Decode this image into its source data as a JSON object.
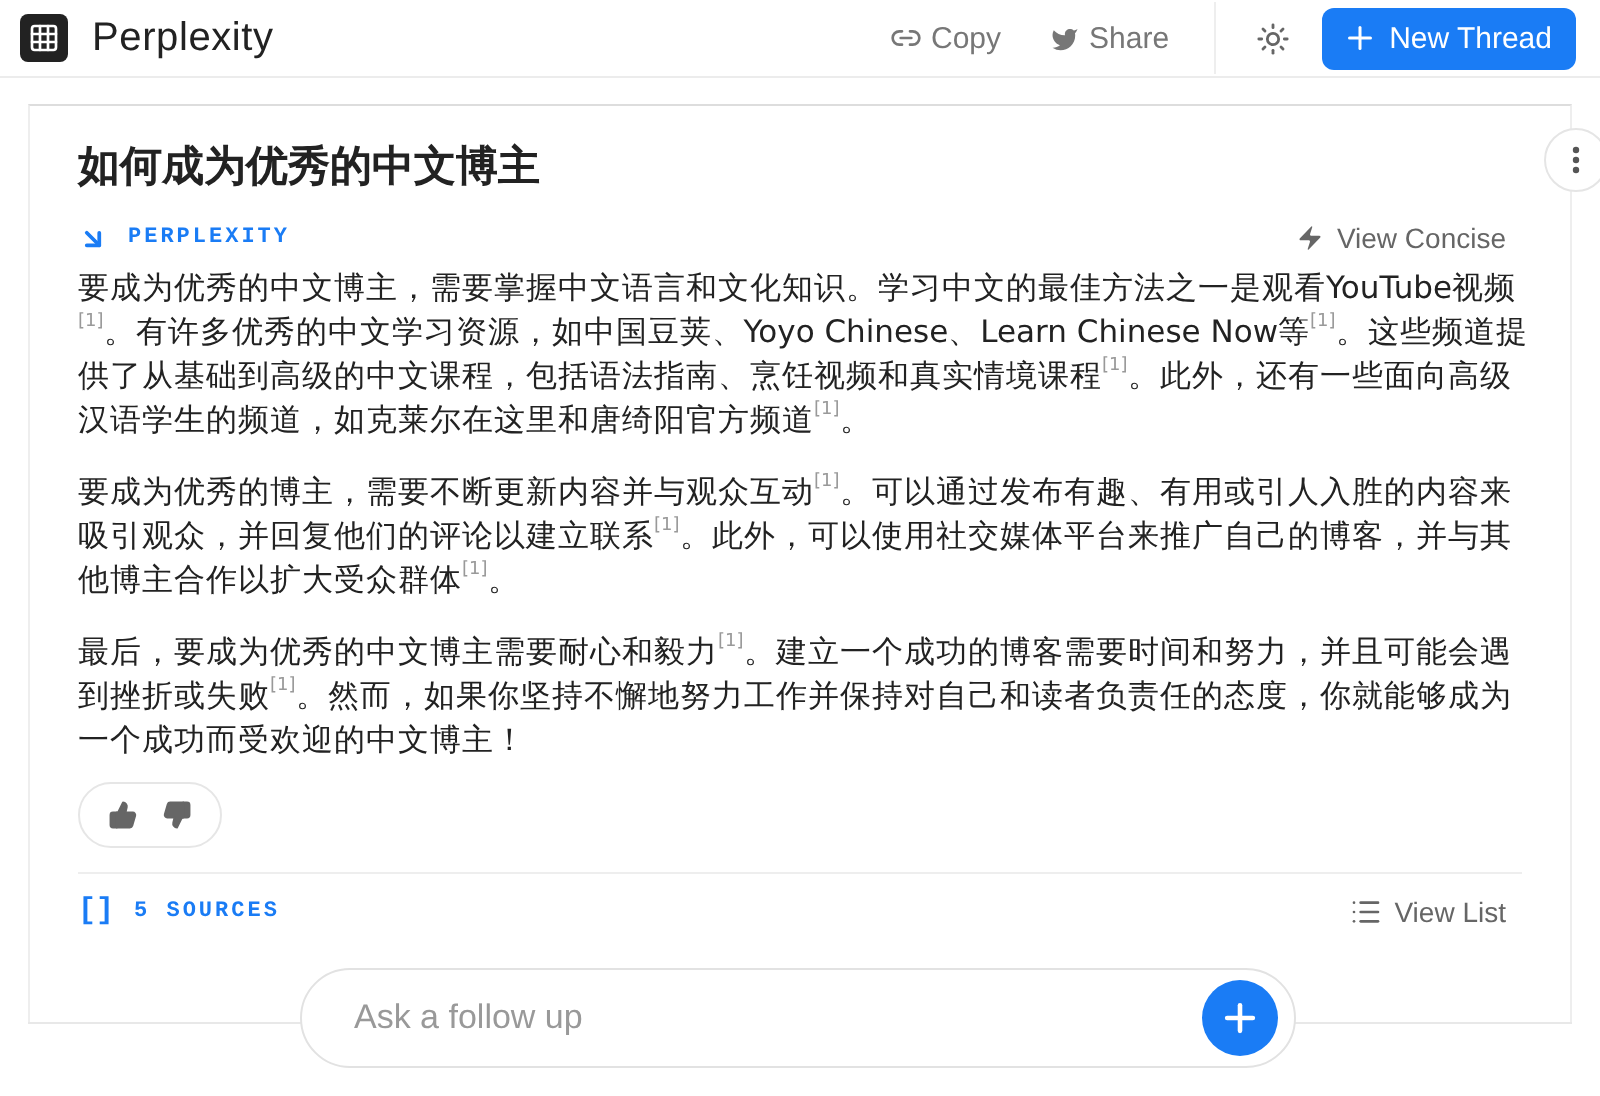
{
  "header": {
    "brand": "Perplexity",
    "actions": [
      {
        "kind": "link",
        "label": "Copy"
      },
      {
        "kind": "twitter",
        "label": "Share"
      }
    ],
    "new_thread": "New Thread"
  },
  "answer": {
    "title": "如何成为优秀的中文博主",
    "source_label": "PERPLEXITY",
    "view_toggle": "View Concise",
    "paragraphs": [
      "要成为优秀的中文博主，需要掌握中文语言和文化知识。学习中文的最佳方法之一是观看YouTube视频$^{[1]}$。有许多优秀的中文学习资源，如中国豆荚、Yoyo Chinese、Learn Chinese Now等$^{[1]}$。这些频道提供了从基础到高级的中文课程，包括语法指南、烹饪视频和真实情境课程$^{[1]}$。此外，还有一些面向高级汉语学生的频道，如克莱尔在这里和唐绮阳官方频道$^{[1]}$。",
      "要成为优秀的博主，需要不断更新内容并与观众互动$^{[1]}$。可以通过发布有趣、有用或引人入胜的内容来吸引观众，并回复他们的评论以建立联系$^{[1]}$。此外，可以使用社交媒体平台来推广自己的博客，并与其他博主合作以扩大受众群体$^{[1]}$。",
      "最后，要成为优秀的中文博主需要耐心和毅力$^{[1]}$。建立一个成功的博客需要时间和努力，并且可能会遇到挫折或失败$^{[1]}$。然而，如果你坚持不懈地努力工作并保持对自己和读者负责任的态度，你就能够成为一个成功而受欢迎的中文博主！"
    ]
  },
  "sources": {
    "brackets": "[]",
    "label": "5 SOURCES",
    "view_list": "View List"
  },
  "follow_up": {
    "placeholder": "Ask a follow up"
  }
}
